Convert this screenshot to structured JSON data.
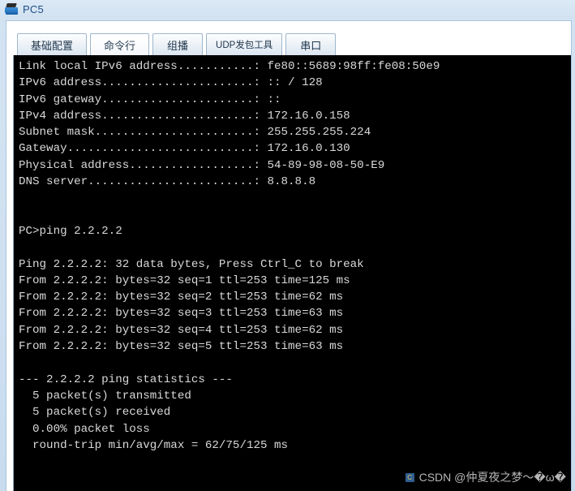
{
  "window": {
    "title": "PC5",
    "icon": "pc-device-icon"
  },
  "tabs": [
    {
      "label": "基础配置",
      "selected": false,
      "small": false
    },
    {
      "label": "命令行",
      "selected": true,
      "small": false
    },
    {
      "label": "组播",
      "selected": false,
      "small": false
    },
    {
      "label": "UDP发包工具",
      "selected": false,
      "small": true
    },
    {
      "label": "串口",
      "selected": false,
      "small": false
    }
  ],
  "terminal": {
    "lines": [
      "Link local IPv6 address...........: fe80::5689:98ff:fe08:50e9",
      "IPv6 address......................: :: / 128",
      "IPv6 gateway......................: ::",
      "IPv4 address......................: 172.16.0.158",
      "Subnet mask.......................: 255.255.255.224",
      "Gateway...........................: 172.16.0.130",
      "Physical address..................: 54-89-98-08-50-E9",
      "DNS server........................: 8.8.8.8",
      "",
      "",
      "PC>ping 2.2.2.2",
      "",
      "Ping 2.2.2.2: 32 data bytes, Press Ctrl_C to break",
      "From 2.2.2.2: bytes=32 seq=1 ttl=253 time=125 ms",
      "From 2.2.2.2: bytes=32 seq=2 ttl=253 time=62 ms",
      "From 2.2.2.2: bytes=32 seq=3 ttl=253 time=63 ms",
      "From 2.2.2.2: bytes=32 seq=4 ttl=253 time=62 ms",
      "From 2.2.2.2: bytes=32 seq=5 ttl=253 time=63 ms",
      "",
      "--- 2.2.2.2 ping statistics ---",
      "  5 packet(s) transmitted",
      "  5 packet(s) received",
      "  0.00% packet loss",
      "  round-trip min/avg/max = 62/75/125 ms"
    ],
    "ip_info": {
      "link_local_ipv6": "fe80::5689:98ff:fe08:50e9",
      "ipv6_address": ":: / 128",
      "ipv6_gateway": "::",
      "ipv4_address": "172.16.0.158",
      "subnet_mask": "255.255.255.224",
      "gateway": "172.16.0.130",
      "physical_address": "54-89-98-08-50-E9",
      "dns_server": "8.8.8.8"
    },
    "ping": {
      "command": "PC>ping 2.2.2.2",
      "target": "2.2.2.2",
      "data_bytes": "32",
      "replies": [
        {
          "seq": "1",
          "bytes": "32",
          "ttl": "253",
          "time": "125 ms"
        },
        {
          "seq": "2",
          "bytes": "32",
          "ttl": "253",
          "time": "62 ms"
        },
        {
          "seq": "3",
          "bytes": "32",
          "ttl": "253",
          "time": "63 ms"
        },
        {
          "seq": "4",
          "bytes": "32",
          "ttl": "253",
          "time": "62 ms"
        },
        {
          "seq": "5",
          "bytes": "32",
          "ttl": "253",
          "time": "63 ms"
        }
      ],
      "statistics": {
        "transmitted": "5 packet(s) transmitted",
        "received": "5 packet(s) received",
        "loss": "0.00% packet loss",
        "round_trip": "round-trip min/avg/max = 62/75/125 ms"
      }
    }
  },
  "watermark": {
    "mark": "C",
    "text": "CSDN @仲夏夜之梦～�ω�"
  },
  "colors": {
    "terminal_bg": "#000000",
    "terminal_fg": "#d9d9d9",
    "window_chrome": "#d2e2f1",
    "title_text": "#1b4f86",
    "tab_border": "#9eb6cc"
  }
}
